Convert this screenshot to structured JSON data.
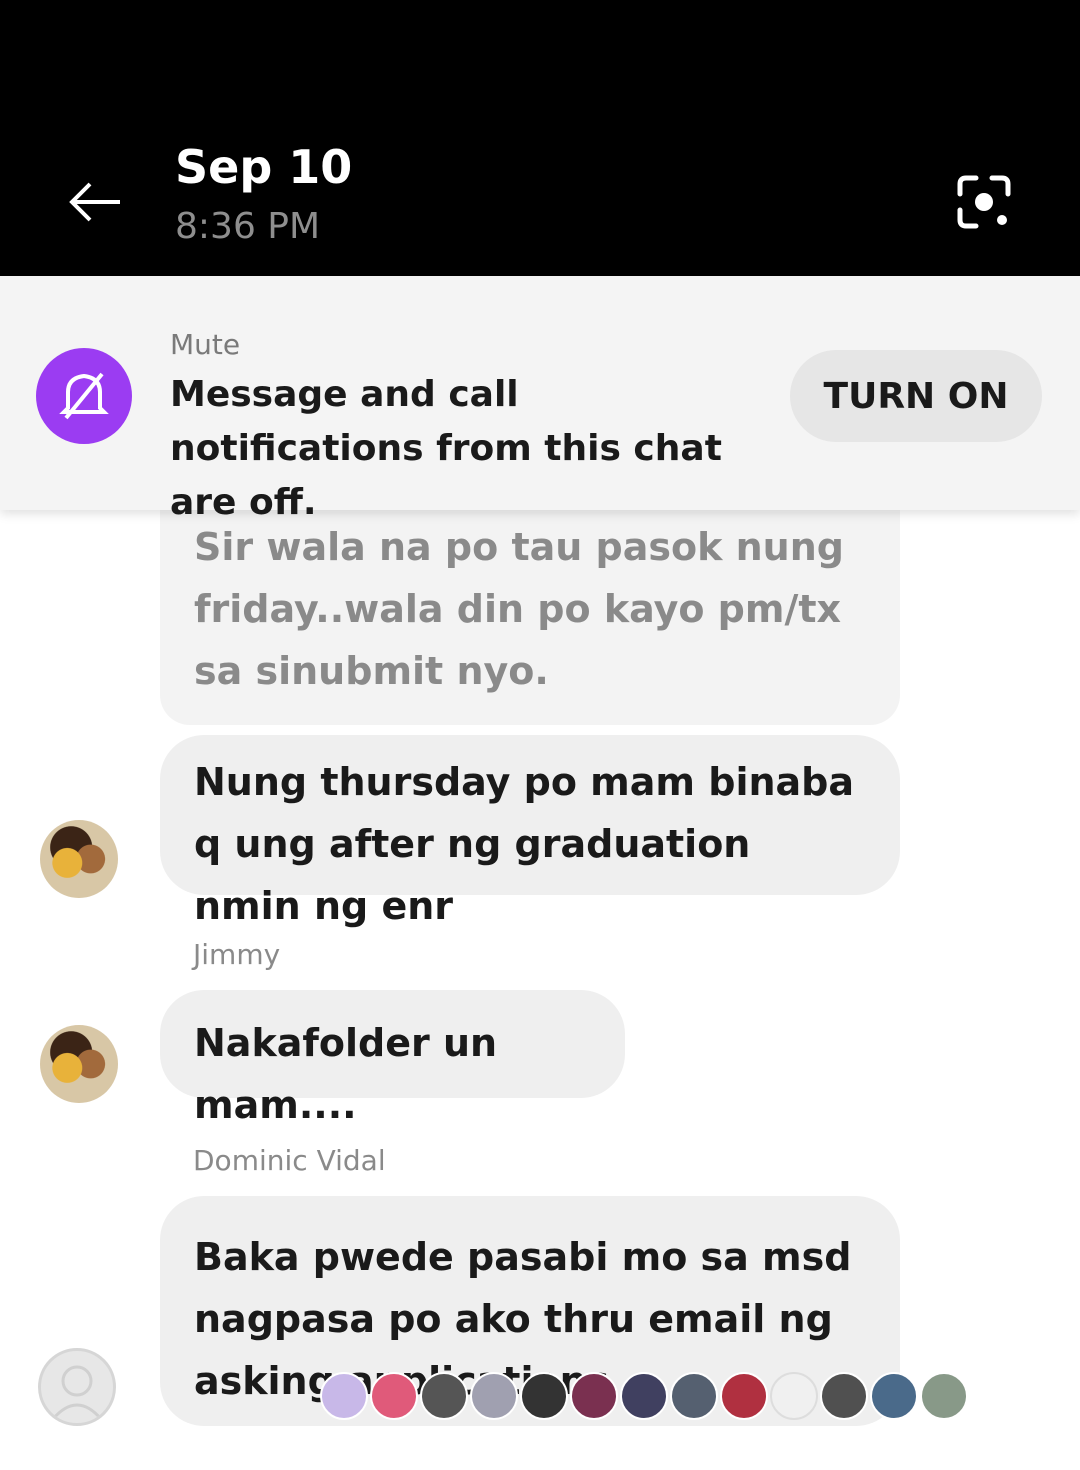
{
  "header": {
    "date": "Sep 10",
    "time": "8:36 PM",
    "back_icon": "arrow-left-icon",
    "lens_icon": "lens-scan-icon"
  },
  "mute_banner": {
    "label": "Mute",
    "description": "Message and call notifications from this chat are off.",
    "button_label": "TURN ON",
    "icon": "bell-muted-icon",
    "accent_color": "#9b3cf2"
  },
  "messages": [
    {
      "sender": "",
      "text": "Sir wala na po tau pasok nung friday..wala din po kayo pm/tx sa sinubmit nyo."
    },
    {
      "sender": "",
      "text": "Nung thursday po mam binaba q ung after ng graduation nmin ng enr"
    },
    {
      "sender": "Jimmy",
      "text": "Nakafolder un mam...."
    },
    {
      "sender": "Dominic Vidal",
      "text": "Baka pwede pasabi mo sa msd nagpasa po ako thru email ng asking applications"
    }
  ],
  "reactions": {
    "icon": "seen-avatars-icon",
    "colors": [
      "#c8b8e8",
      "#e05a7a",
      "#555555",
      "#a0a0b0",
      "#333333",
      "#7a3050",
      "#404060",
      "#556070",
      "#b03040",
      "#f0f0f0",
      "#505050",
      "#4a6a8a",
      "#889988"
    ]
  }
}
